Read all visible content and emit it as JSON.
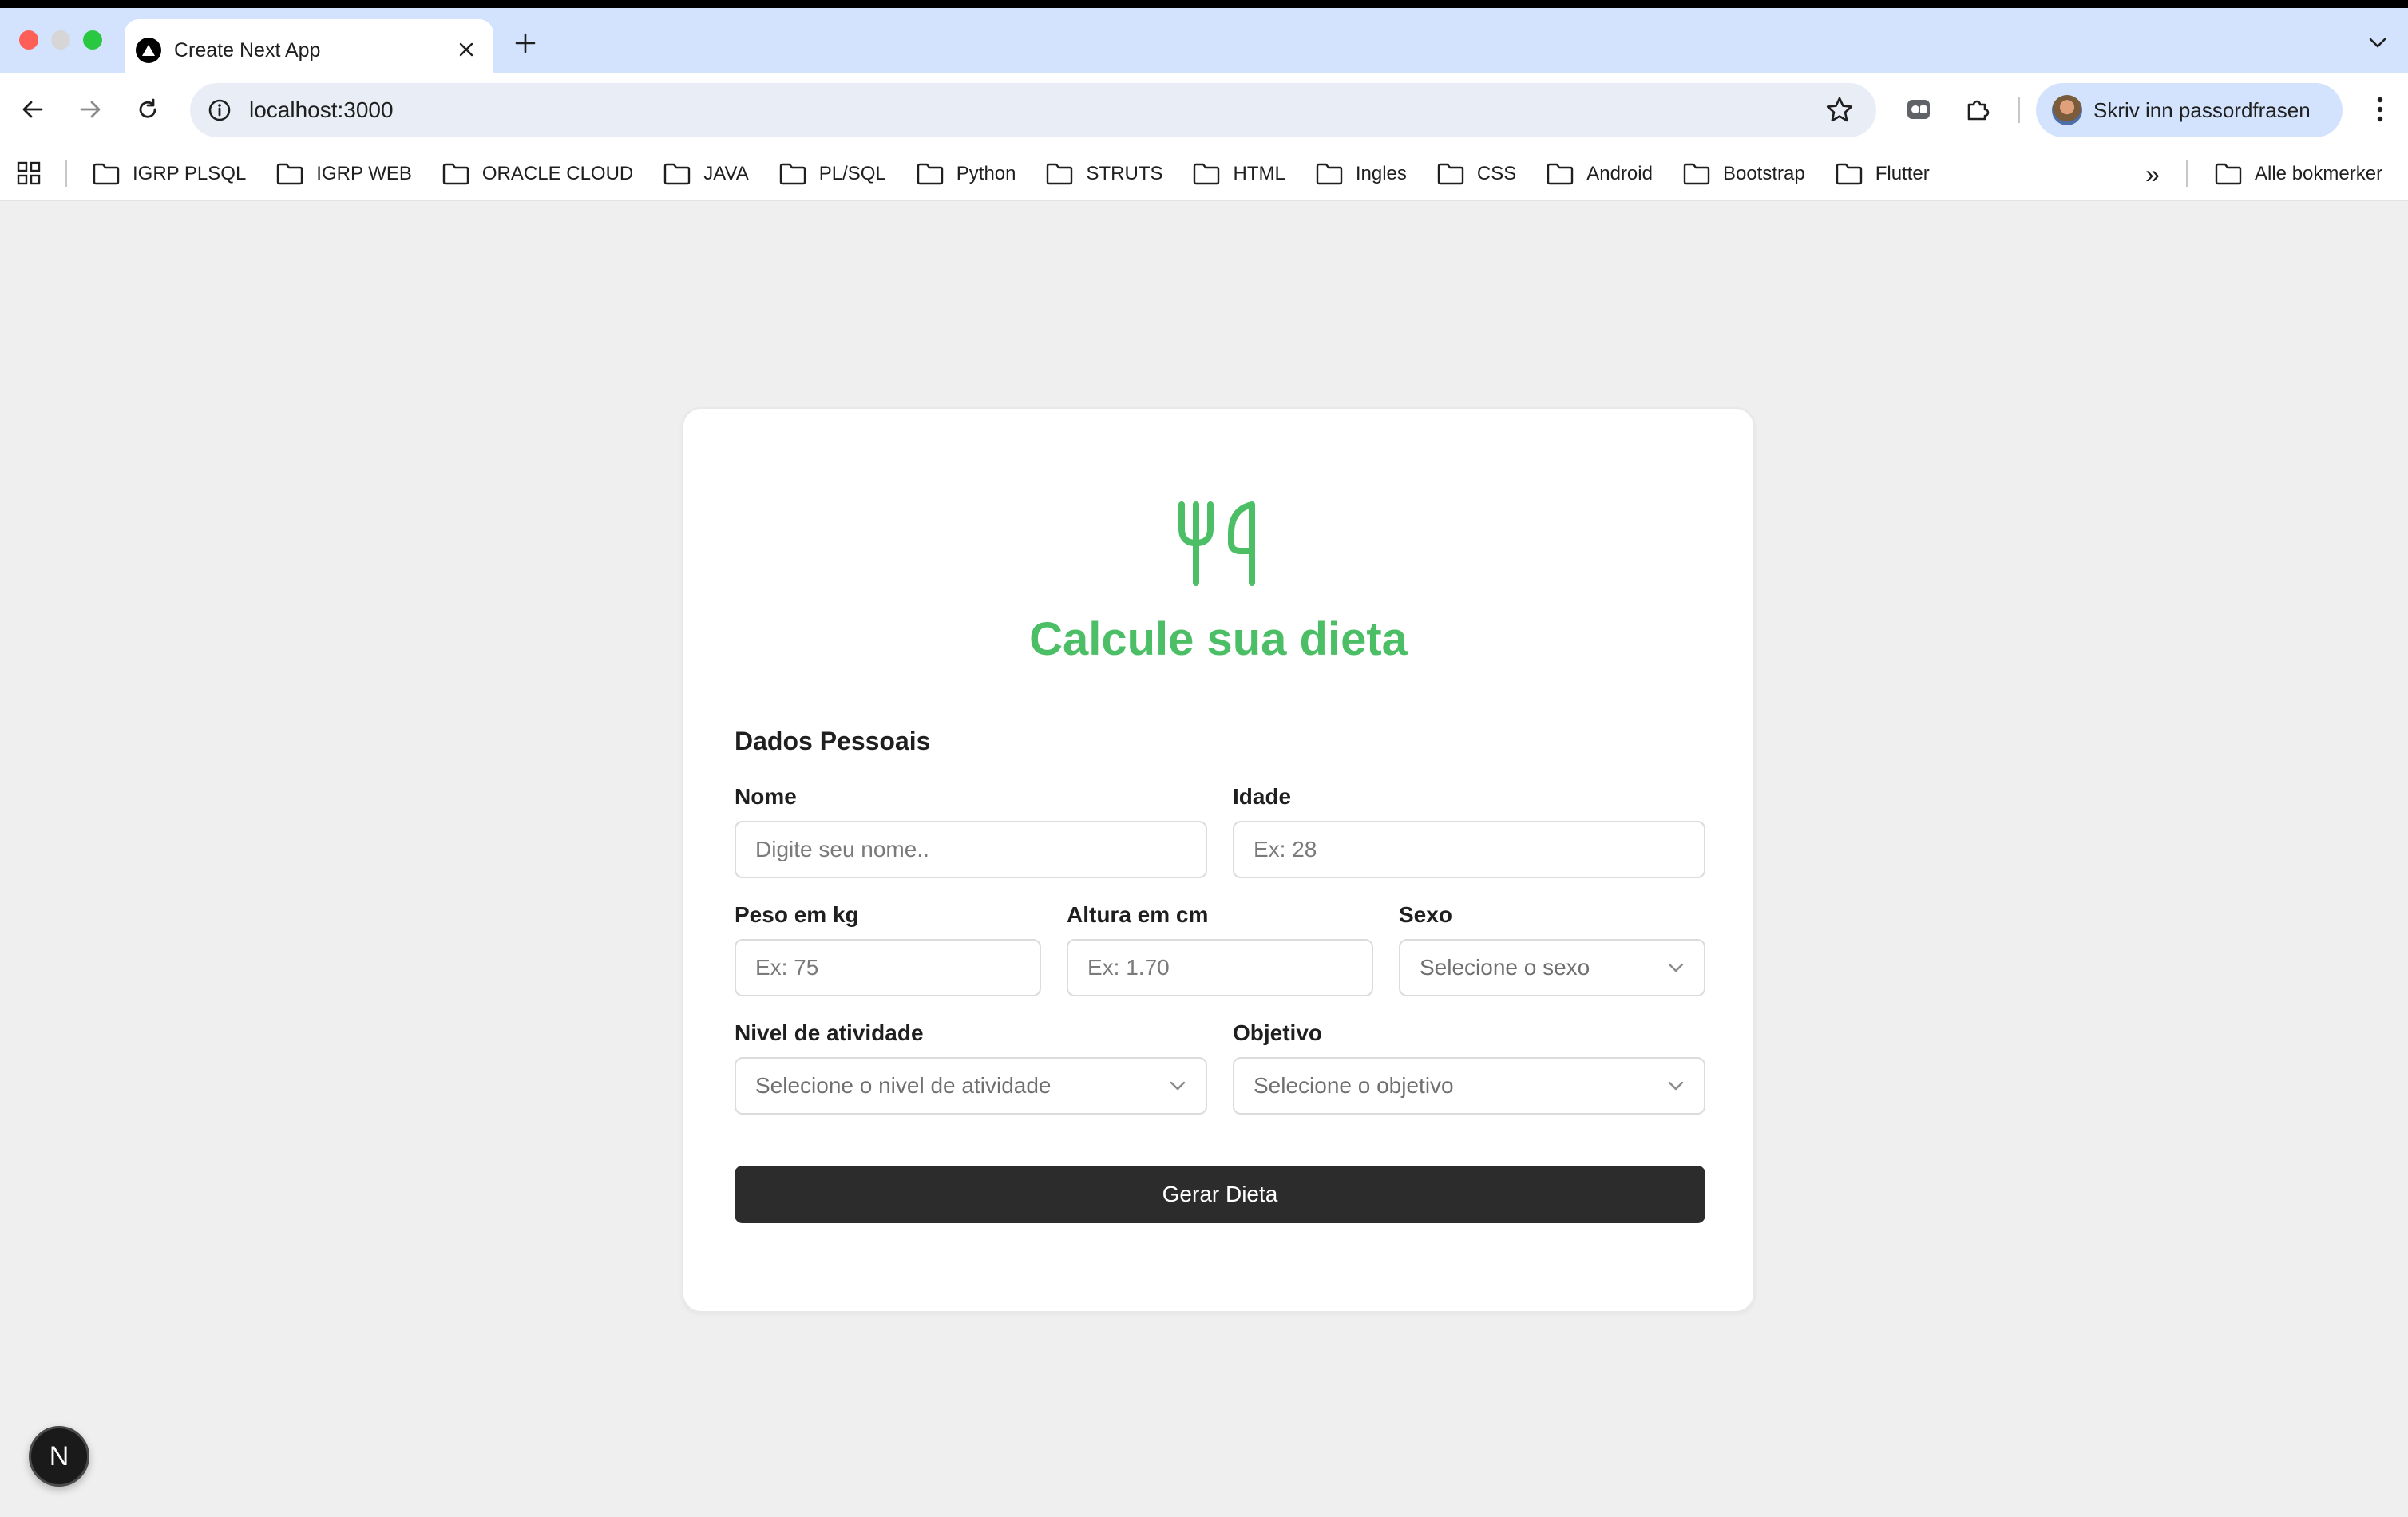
{
  "browser": {
    "tab": {
      "title": "Create Next App"
    },
    "address_bar": {
      "url": "localhost:3000"
    },
    "profile": {
      "label": "Skriv inn passordfrasen"
    },
    "bookmarks": [
      "IGRP PLSQL",
      "IGRP WEB",
      "ORACLE CLOUD",
      "JAVA",
      "PL/SQL",
      "Python",
      "STRUTS",
      "HTML",
      "Ingles",
      "CSS",
      "Android",
      "Bootstrap",
      "Flutter"
    ],
    "all_bookmarks_label": "Alle bokmerker"
  },
  "form": {
    "title": "Calcule sua dieta",
    "section_title": "Dados Pessoais",
    "fields": {
      "nome": {
        "label": "Nome",
        "placeholder": "Digite seu nome..",
        "value": ""
      },
      "idade": {
        "label": "Idade",
        "placeholder": "Ex: 28",
        "value": ""
      },
      "peso": {
        "label": "Peso em kg",
        "placeholder": "Ex: 75",
        "value": ""
      },
      "altura": {
        "label": "Altura em cm",
        "placeholder": "Ex: 1.70",
        "value": ""
      },
      "sexo": {
        "label": "Sexo",
        "selected": "Selecione o sexo"
      },
      "nivel": {
        "label": "Nivel de atividade",
        "selected": "Selecione o nivel de atividade"
      },
      "objetivo": {
        "label": "Objetivo",
        "selected": "Selecione o objetivo"
      }
    },
    "submit_label": "Gerar Dieta"
  },
  "dev_indicator": {
    "label": "N"
  },
  "colors": {
    "accent": "#4cbf66",
    "button": "#2c2c2c",
    "page_background": "#efefef",
    "tabstrip": "#d3e3fd"
  },
  "icons": {
    "logo": "utensils-icon",
    "bookmark": "folder-icon",
    "select_arrow": "chevron-down-icon"
  }
}
